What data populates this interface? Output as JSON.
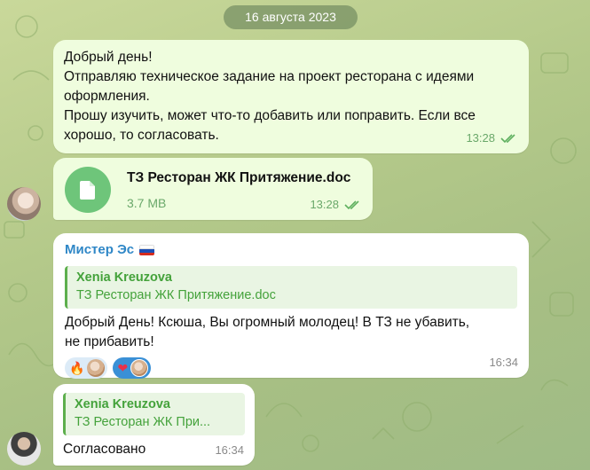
{
  "date_separator": "16 августа 2023",
  "messages": {
    "m1": {
      "lines": [
        "Добрый день!",
        "Отправляю техническое задание на проект ресторана с идеями",
        "оформления.",
        "Прошу изучить, может что-то добавить или поправить. Если все",
        "хорошо, то согласовать."
      ],
      "time": "13:28"
    },
    "m2": {
      "file_name": "ТЗ Ресторан ЖК  Притяжение.doc",
      "file_size": "3.7 MB",
      "time": "13:28"
    },
    "m3": {
      "sender": "Мистер Эс",
      "reply_name": "Xenia Kreuzova",
      "reply_text": "ТЗ Ресторан ЖК  Притяжение.doc",
      "text_line1": "Добрый День! Ксюша, Вы огромный молодец! В ТЗ не убавить,",
      "text_line2": "не прибавить!",
      "reactions": [
        {
          "emoji": "🔥"
        },
        {
          "emoji": "❤"
        }
      ],
      "time": "16:34"
    },
    "m4": {
      "reply_name": "Xenia Kreuzova",
      "reply_text": "ТЗ Ресторан ЖК  При...",
      "text": "Согласовано",
      "time": "16:34"
    }
  },
  "colors": {
    "outgoing_bubble": "#effdde",
    "incoming_bubble": "#ffffff",
    "accent_green": "#44a23b",
    "sender_blue": "#2f87c7"
  }
}
